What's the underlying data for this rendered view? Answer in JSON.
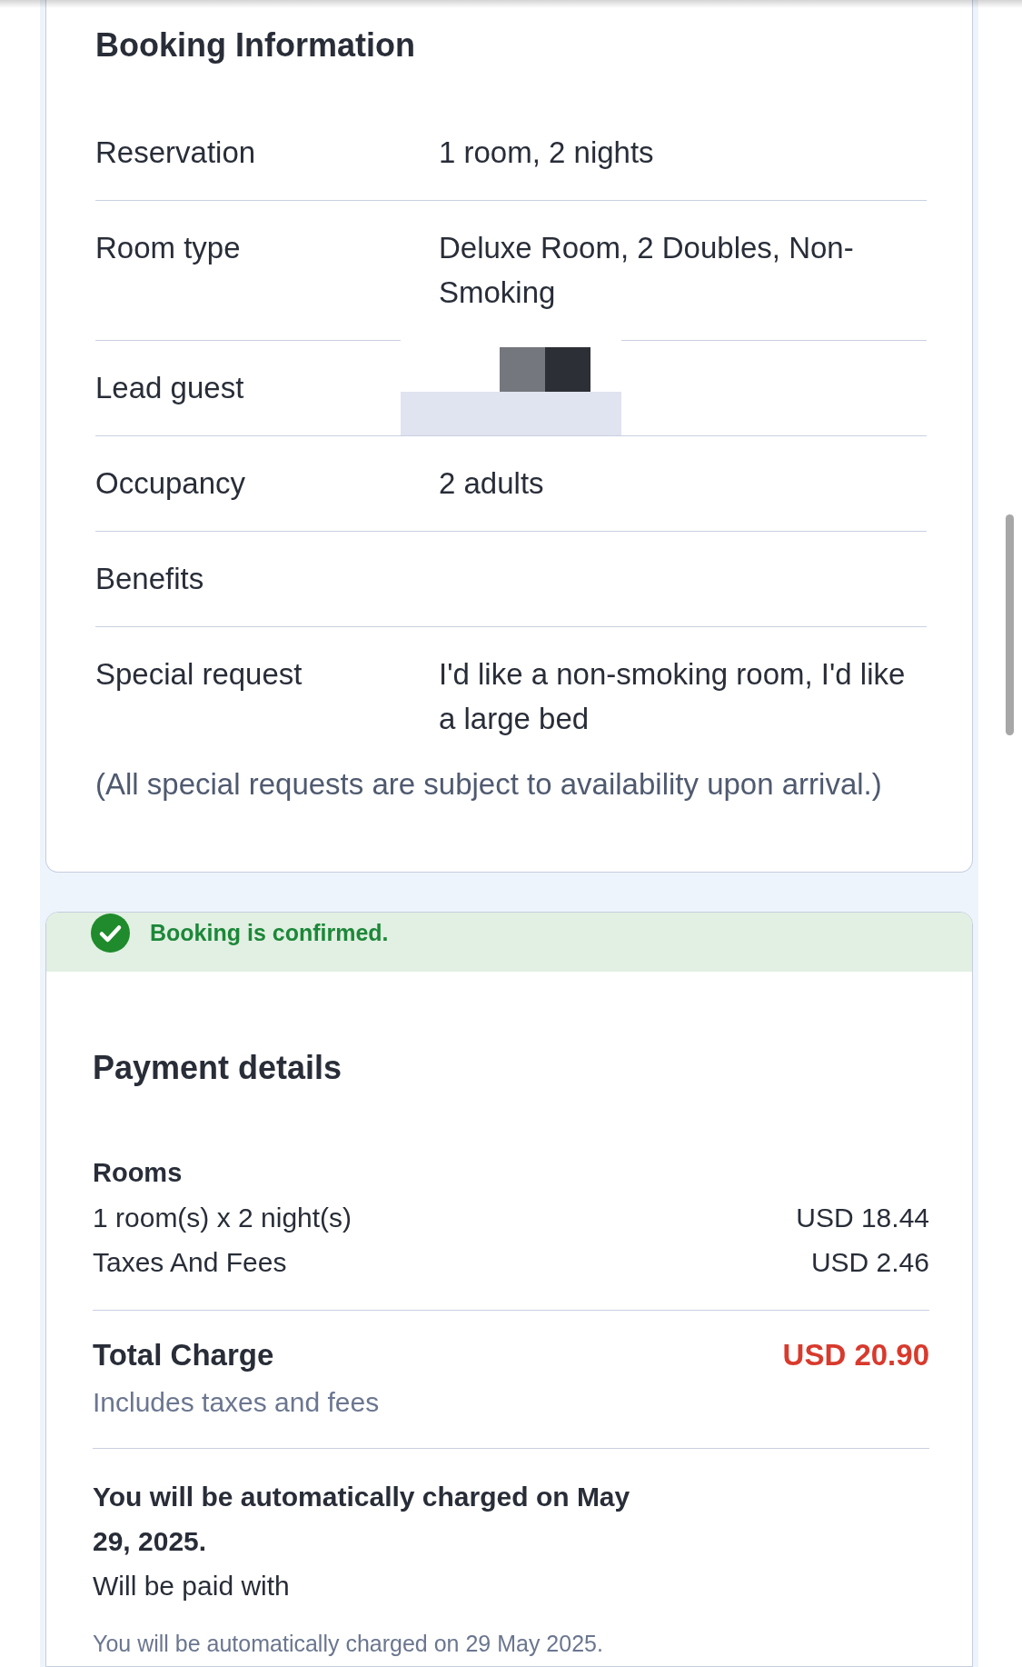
{
  "booking_information": {
    "title": "Booking Information",
    "rows": [
      {
        "label": "Reservation",
        "kind": "text",
        "value": "1 room, 2 nights"
      },
      {
        "label": "Room type",
        "kind": "text",
        "value": "Deluxe Room, 2 Doubles, Non-Smoking"
      },
      {
        "label": "Lead guest",
        "kind": "redacted"
      },
      {
        "label": "Occupancy",
        "kind": "text",
        "value": "2 adults"
      },
      {
        "label": "Benefits",
        "kind": "text"
      },
      {
        "label": "Special request",
        "kind": "text",
        "value": "I'd like a non-smoking room, I'd like a large bed"
      }
    ],
    "note": "(All special requests are subject to availability upon arrival.)"
  },
  "status_banner": {
    "kind": "success",
    "text": "Booking is confirmed."
  },
  "payment_details": {
    "title": "Payment details",
    "section_title": "Rooms",
    "line_items": [
      {
        "label": "1 room(s) x 2 night(s)",
        "amount": "USD 18.44"
      },
      {
        "label": "Taxes And Fees",
        "amount": "USD 2.46"
      }
    ],
    "total": {
      "label": "Total Charge",
      "amount": "USD 20.90",
      "note": "Includes taxes and fees"
    },
    "charge_notice": "You will be automatically charged on May 29, 2025.",
    "payment_method_label": "Will be paid with",
    "footnote": "You will be automatically charged on 29 May 2025."
  }
}
